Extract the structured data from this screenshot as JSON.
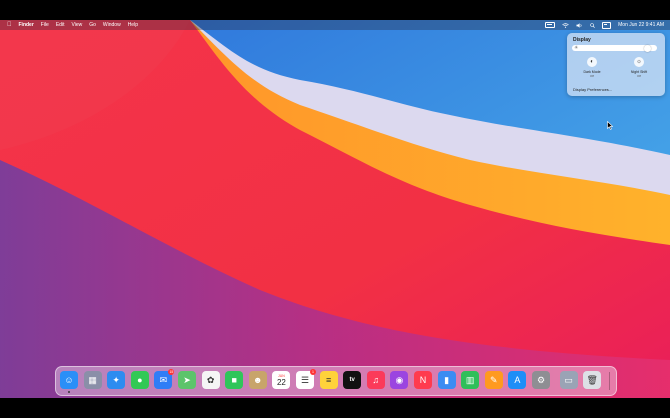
{
  "menubar": {
    "app_name": "Finder",
    "menus": [
      "File",
      "Edit",
      "View",
      "Go",
      "Window",
      "Help"
    ],
    "clock": "Mon Jun 22  9:41 AM"
  },
  "display_panel": {
    "title": "Display",
    "brightness": 0.92,
    "dark_mode": {
      "label": "Dark Mode",
      "state": "Off"
    },
    "night_shift": {
      "label": "Night Shift",
      "state": "Off"
    },
    "preferences_link": "Display Preferences..."
  },
  "dock": {
    "apps": [
      {
        "name": "Finder",
        "icon": "finder-icon",
        "color": "#2a8ff7",
        "glyph": "☺",
        "running": true
      },
      {
        "name": "Launchpad",
        "icon": "launchpad-icon",
        "color": "#8a8fa8",
        "glyph": "▦",
        "running": false
      },
      {
        "name": "Safari",
        "icon": "safari-icon",
        "color": "#2d8cf0",
        "glyph": "✦",
        "running": false
      },
      {
        "name": "Messages",
        "icon": "messages-icon",
        "color": "#32c955",
        "glyph": "●",
        "running": false
      },
      {
        "name": "Mail",
        "icon": "mail-icon",
        "color": "#2f7df6",
        "glyph": "✉",
        "running": false,
        "badge": "15"
      },
      {
        "name": "Maps",
        "icon": "maps-icon",
        "color": "#5cc46b",
        "glyph": "➤",
        "running": false
      },
      {
        "name": "Photos",
        "icon": "photos-icon",
        "color": "#f5f5f5",
        "glyph": "✿",
        "running": false
      },
      {
        "name": "FaceTime",
        "icon": "facetime-icon",
        "color": "#2fc55a",
        "glyph": "■",
        "running": false
      },
      {
        "name": "Contacts",
        "icon": "contacts-icon",
        "color": "#c8a46a",
        "glyph": "☻",
        "running": false
      },
      {
        "name": "Calendar",
        "icon": "calendar-icon",
        "color": "#ffffff",
        "glyph": "22",
        "calendar_month": "JUN",
        "running": false
      },
      {
        "name": "Reminders",
        "icon": "reminders-icon",
        "color": "#ffffff",
        "glyph": "☰",
        "running": false,
        "badge": "1"
      },
      {
        "name": "Notes",
        "icon": "notes-icon",
        "color": "#ffd23a",
        "glyph": "≡",
        "running": false
      },
      {
        "name": "TV",
        "icon": "tv-icon",
        "color": "#111111",
        "glyph": "tv",
        "running": false
      },
      {
        "name": "Music",
        "icon": "music-icon",
        "color": "#fb3a5a",
        "glyph": "♫",
        "running": false
      },
      {
        "name": "Podcasts",
        "icon": "podcasts-icon",
        "color": "#9b45e0",
        "glyph": "◉",
        "running": false
      },
      {
        "name": "News",
        "icon": "news-icon",
        "color": "#ff3b4e",
        "glyph": "N",
        "running": false
      },
      {
        "name": "Keynote",
        "icon": "keynote-icon",
        "color": "#3b8cf2",
        "glyph": "▮",
        "running": false
      },
      {
        "name": "Numbers",
        "icon": "numbers-icon",
        "color": "#2fbf5a",
        "glyph": "▥",
        "running": false
      },
      {
        "name": "Pages",
        "icon": "pages-icon",
        "color": "#ff9a1f",
        "glyph": "✎",
        "running": false
      },
      {
        "name": "App Store",
        "icon": "app-store-icon",
        "color": "#1e8ef7",
        "glyph": "A",
        "running": false
      },
      {
        "name": "System Preferences",
        "icon": "system-preferences-icon",
        "color": "#8e8e93",
        "glyph": "⚙",
        "running": false
      },
      {
        "name": "Preview",
        "icon": "preview-icon",
        "color": "#9aa3b5",
        "glyph": "▭",
        "running": false
      },
      {
        "name": "Trash",
        "icon": "trash-icon",
        "color": "#dde0e6",
        "glyph": "🗑",
        "running": false
      }
    ]
  }
}
